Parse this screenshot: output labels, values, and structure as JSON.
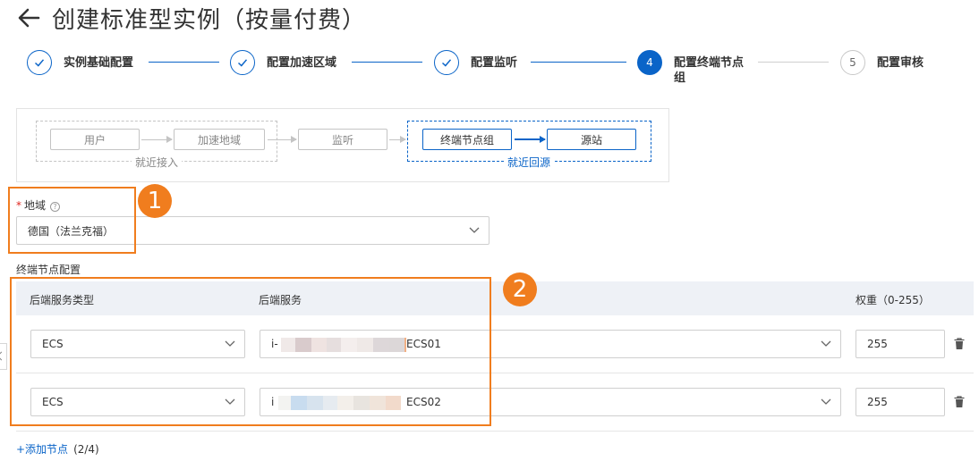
{
  "page": {
    "title": "创建标准型实例（按量付费）"
  },
  "steps": [
    {
      "index": "1",
      "label": "实例基础配置",
      "status": "done"
    },
    {
      "index": "2",
      "label": "配置加速区域",
      "status": "done"
    },
    {
      "index": "3",
      "label": "配置监听",
      "status": "done"
    },
    {
      "index": "4",
      "label_line1": "配置终端节点",
      "label_line2": "组",
      "status": "active"
    },
    {
      "index": "5",
      "label": "配置审核",
      "status": "pending"
    }
  ],
  "flow": {
    "nodes": {
      "user": "用户",
      "accel_region": "加速地域",
      "listener": "监听",
      "endpoint_group": "终端节点组",
      "origin": "源站"
    },
    "group_labels": {
      "nearby_access": "就近接入",
      "nearby_origin": "就近回源"
    }
  },
  "region": {
    "label": "地域",
    "value": "德国（法兰克福）"
  },
  "endpoint_config": {
    "section_label": "终端节点配置",
    "headers": {
      "backend_type": "后端服务类型",
      "backend_service": "后端服务",
      "weight": "权重（0-255）"
    },
    "rows": [
      {
        "backend_type": "ECS",
        "instance_prefix": "i-",
        "instance_suffix": "ECS01",
        "weight": "255"
      },
      {
        "backend_type": "ECS",
        "instance_prefix": "i",
        "instance_suffix": "ECS02",
        "weight": "255"
      }
    ],
    "add_link": "+添加节点",
    "add_count": "(2/4)"
  },
  "annotations": {
    "one": "1",
    "two": "2"
  },
  "colors": {
    "primary": "#0a64c8",
    "annotation": "#f07d1e",
    "required": "#e0261e",
    "table_header": "#eef1f6"
  }
}
